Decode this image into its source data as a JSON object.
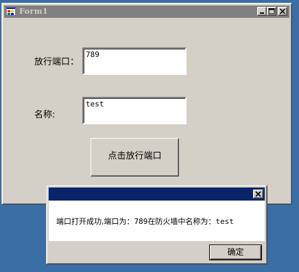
{
  "window": {
    "title": "Form1",
    "port_label": "放行端口：",
    "port_value": "789",
    "name_label": "名称:",
    "name_value": "test",
    "open_button": "点击放行端口"
  },
  "dialog": {
    "message_prefix": "端口打开成功,端口为：",
    "message_port": "789",
    "message_middle": "在防火墙中名称为：",
    "message_name": "test",
    "ok_button": "确定"
  },
  "colors": {
    "desktop": "#3a6ea5",
    "face": "#d4d0c8",
    "inactive_title": "#808080",
    "active_title": "#0a246a"
  }
}
